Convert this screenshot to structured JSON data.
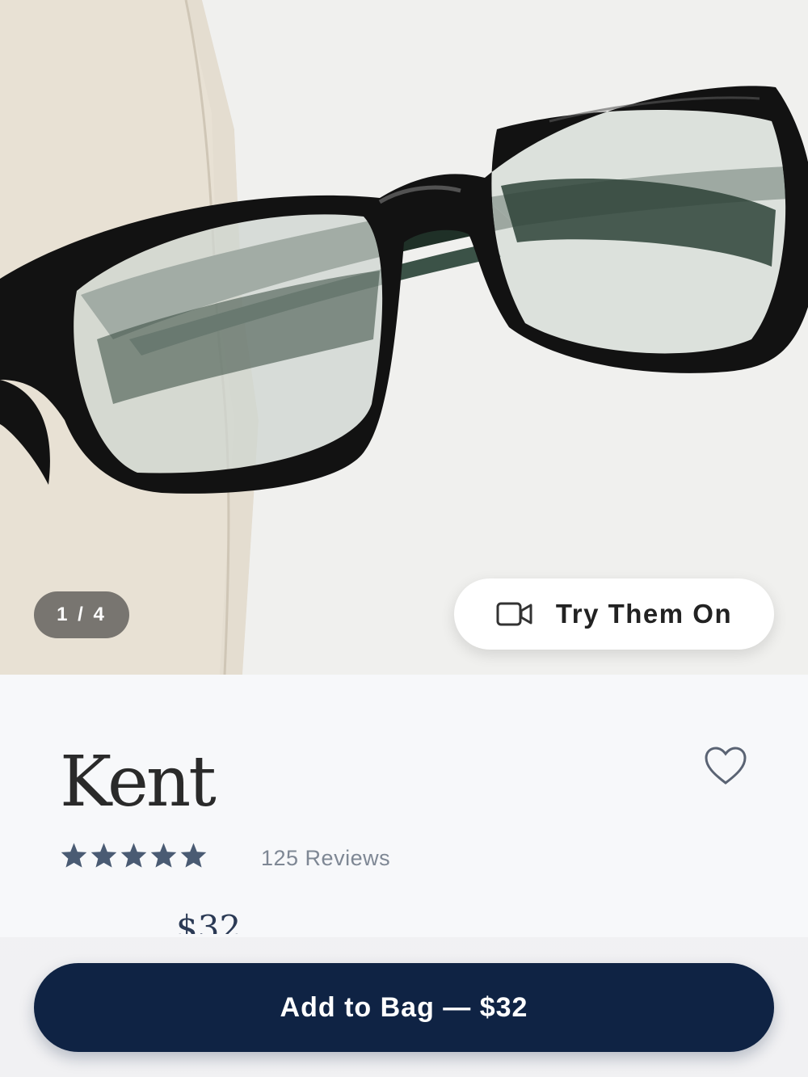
{
  "gallery": {
    "counter": "1 / 4",
    "try_on_label": "Try Them On",
    "try_on_icon": "video-camera-icon"
  },
  "product": {
    "name": "Kent",
    "rating": 5,
    "rating_max": 5,
    "reviews_label": "125 Reviews",
    "price_partial": "$32",
    "star_color": "#4a5b73"
  },
  "actions": {
    "add_to_bag_label": "Add to Bag — $32",
    "favorite_icon": "heart-icon",
    "button_color": "#0f2344"
  }
}
